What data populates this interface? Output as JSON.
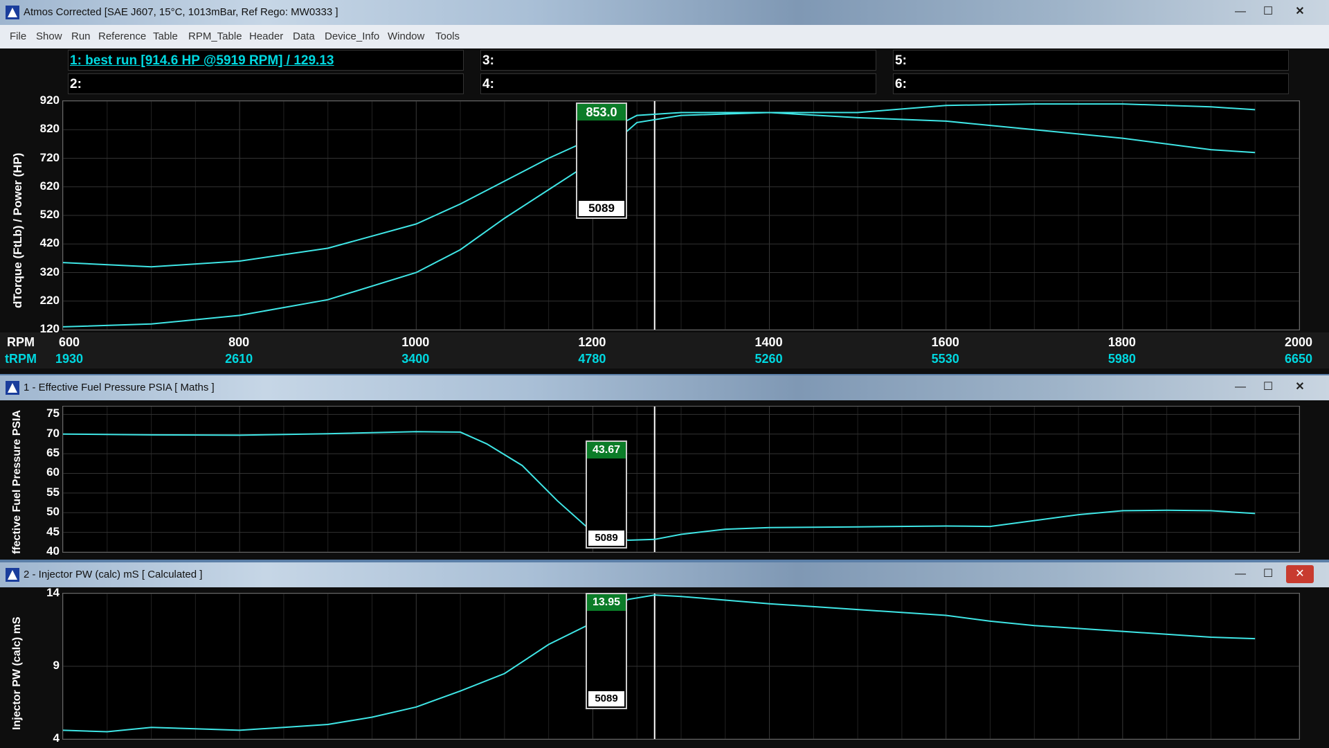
{
  "main_window": {
    "title": "Atmos Corrected [SAE J607, 15°C, 1013mBar,  Ref Rego: MW0333 ]",
    "controls": {
      "minimize": "—",
      "maximize": "☐",
      "close": "✕"
    }
  },
  "menu": [
    "File",
    "Show",
    "Run",
    "Reference",
    "Table",
    "RPM_Table",
    "Header",
    "Data",
    "Device_Info",
    "Window",
    "Tools"
  ],
  "run_slots": [
    {
      "label": "1:     best run [914.6 HP @5919 RPM] / 129.13",
      "active": true
    },
    {
      "label": "2:"
    },
    {
      "label": "3:"
    },
    {
      "label": "4:"
    },
    {
      "label": "5:"
    },
    {
      "label": "6:"
    }
  ],
  "top_chart": {
    "ylabel": "dTorque (FtLb) / Power (HP)",
    "xlabel": "RPM",
    "tlabel": "tRPM",
    "cursor_value": "853.0",
    "cursor_rpm": "5089"
  },
  "fuel_window": {
    "title": "1 - Effective Fuel Pressure PSIA      [ Maths ]",
    "ylabel": "ffective Fuel Pressure PSIA",
    "cursor_value": "43.67",
    "cursor_rpm": "5089"
  },
  "injector_window": {
    "title": "2 - Injector PW (calc) mS      [ Calculated ]",
    "ylabel": "Injector PW (calc) mS",
    "cursor_value": "13.95",
    "cursor_rpm": "5089"
  },
  "chart_data": [
    {
      "type": "line",
      "xlabel": "RPM",
      "ylabel": "dTorque (FtLb) / Power (HP)",
      "xlim": [
        600,
        2000
      ],
      "ylim": [
        120,
        920
      ],
      "x_ticks": [
        600,
        800,
        1000,
        1200,
        1400,
        1600,
        1800,
        2000
      ],
      "y_ticks": [
        120,
        220,
        320,
        420,
        520,
        620,
        720,
        820,
        920
      ],
      "trpm_ticks": [
        "1930",
        "2610",
        "3400",
        "4780",
        "5260",
        "5530",
        "5980",
        "6650"
      ],
      "cursor_x": 1270,
      "series": [
        {
          "x": [
            600,
            700,
            800,
            900,
            1000,
            1050,
            1100,
            1150,
            1200,
            1250,
            1300,
            1400,
            1500,
            1600,
            1700,
            1800,
            1900,
            1950
          ],
          "y": [
            355,
            340,
            360,
            405,
            490,
            560,
            640,
            720,
            790,
            870,
            880,
            880,
            880,
            905,
            910,
            910,
            900,
            890
          ]
        },
        {
          "x": [
            600,
            700,
            800,
            900,
            1000,
            1050,
            1100,
            1150,
            1200,
            1250,
            1300,
            1400,
            1500,
            1600,
            1700,
            1800,
            1900,
            1950
          ],
          "y": [
            130,
            140,
            170,
            225,
            320,
            400,
            510,
            610,
            710,
            845,
            870,
            880,
            862,
            850,
            820,
            790,
            750,
            740
          ]
        }
      ]
    },
    {
      "type": "line",
      "ylabel": "ffective Fuel Pressure PSIA",
      "xlim": [
        600,
        2000
      ],
      "ylim": [
        40,
        77
      ],
      "y_ticks": [
        40,
        45,
        50,
        55,
        60,
        65,
        70,
        75
      ],
      "cursor_x": 1270,
      "series": [
        {
          "x": [
            600,
            700,
            800,
            900,
            1000,
            1050,
            1080,
            1120,
            1160,
            1200,
            1240,
            1270,
            1300,
            1350,
            1400,
            1500,
            1600,
            1650,
            1700,
            1750,
            1800,
            1850,
            1900,
            1950
          ],
          "y": [
            70,
            69.8,
            69.7,
            70.1,
            70.6,
            70.5,
            67.5,
            62,
            53,
            45,
            43,
            43.2,
            44.5,
            45.8,
            46.2,
            46.4,
            46.6,
            46.5,
            48,
            49.5,
            50.5,
            50.6,
            50.5,
            49.8
          ]
        }
      ]
    },
    {
      "type": "line",
      "ylabel": "Injector PW (calc) mS",
      "xlim": [
        600,
        2000
      ],
      "ylim": [
        4,
        14
      ],
      "y_ticks": [
        4,
        9,
        14
      ],
      "cursor_x": 1270,
      "series": [
        {
          "x": [
            600,
            650,
            700,
            750,
            800,
            850,
            900,
            950,
            1000,
            1050,
            1100,
            1150,
            1200,
            1240,
            1270,
            1300,
            1400,
            1500,
            1600,
            1650,
            1700,
            1800,
            1900,
            1950
          ],
          "y": [
            4.6,
            4.5,
            4.8,
            4.7,
            4.6,
            4.8,
            5.0,
            5.5,
            6.2,
            7.3,
            8.5,
            10.5,
            12,
            13.6,
            13.9,
            13.8,
            13.3,
            12.9,
            12.5,
            12.1,
            11.8,
            11.4,
            11.0,
            10.9
          ]
        }
      ]
    }
  ]
}
